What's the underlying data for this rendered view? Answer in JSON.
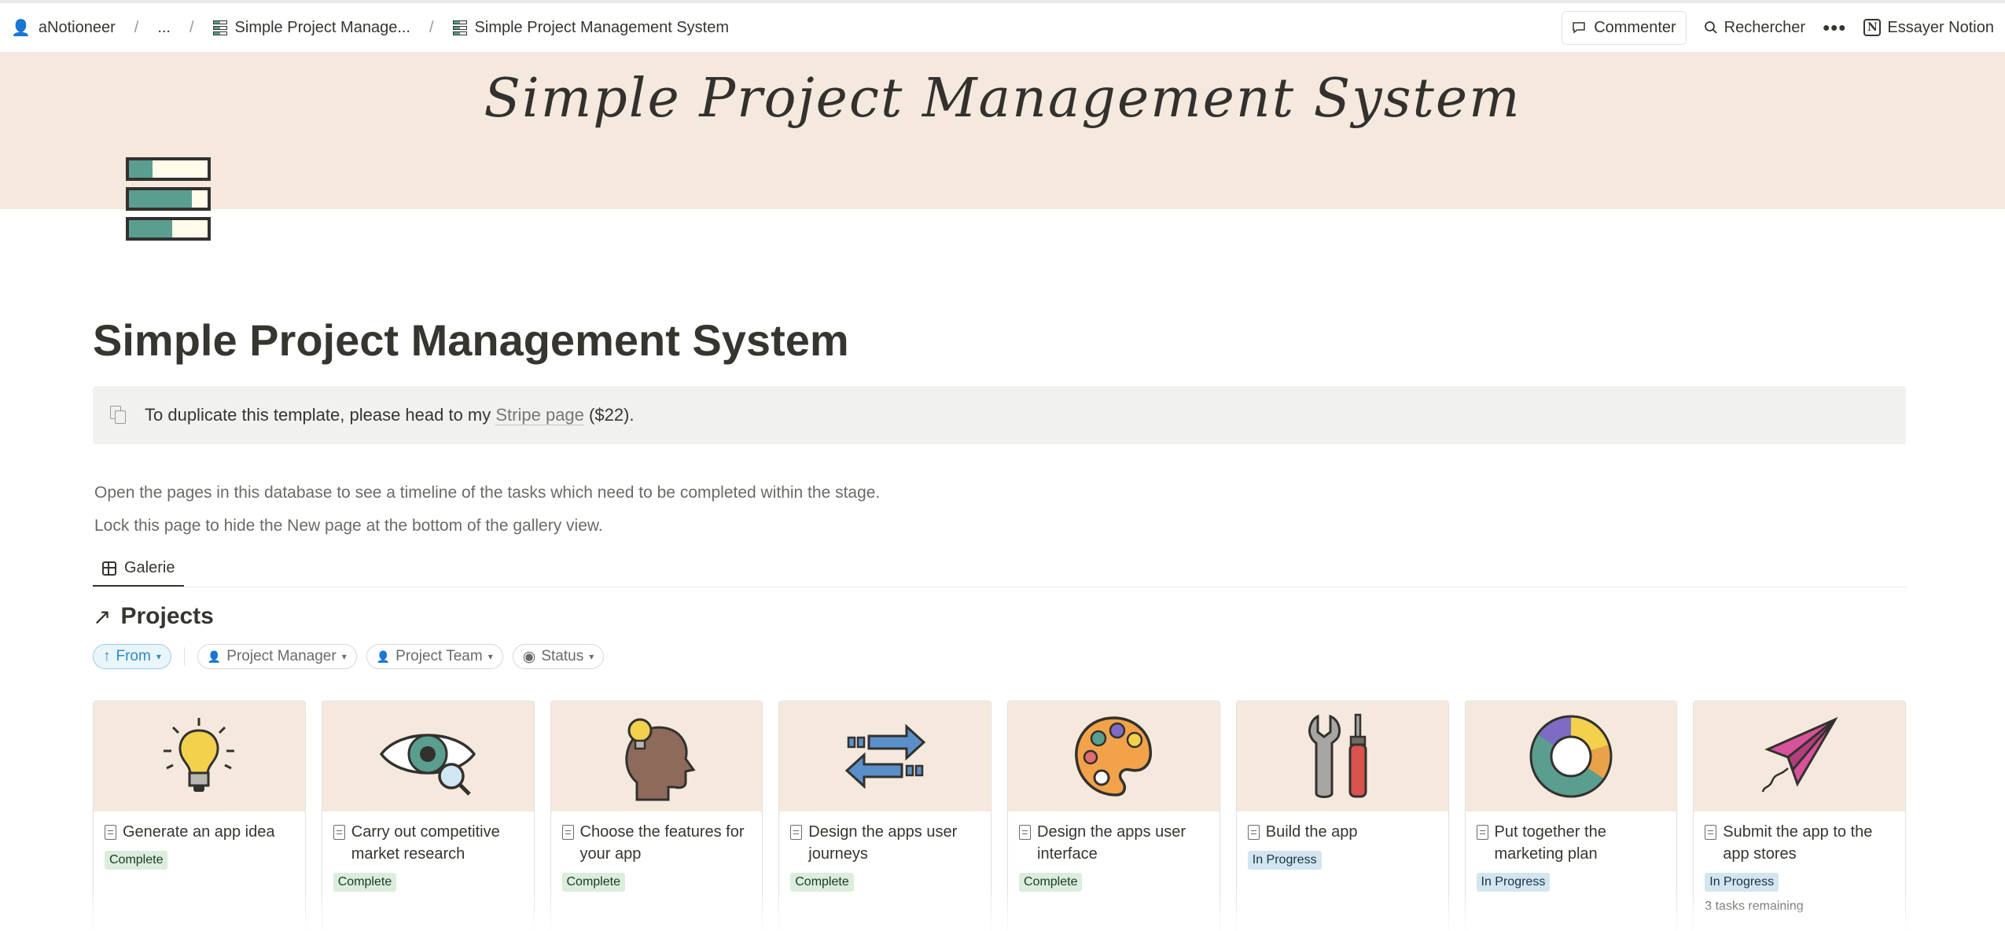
{
  "breadcrumb": {
    "workspace": "aNotioneer",
    "ellipsis": "...",
    "parent": "Simple Project Manage...",
    "current": "Simple Project Management System"
  },
  "topbar": {
    "comment": "Commenter",
    "search": "Rechercher",
    "more": "•••",
    "try_notion": "Essayer Notion"
  },
  "cover": {
    "title": "Simple Project Management System"
  },
  "page": {
    "title": "Simple Project Management System",
    "callout_before": "To duplicate this template, please head to my ",
    "callout_link": "Stripe page",
    "callout_after": " ($22).",
    "para1": "Open the pages in this database to see a timeline of the tasks which need to be completed within the stage.",
    "para2": "Lock this page to hide the New page at the bottom of the gallery view."
  },
  "view": {
    "tab": "Galerie",
    "db_title": "Projects"
  },
  "filters": {
    "sort": "From",
    "project_manager": "Project Manager",
    "project_team": "Project Team",
    "status": "Status"
  },
  "cards": [
    {
      "title": "Generate an app idea",
      "status": "Complete",
      "extra": ""
    },
    {
      "title": "Carry out competitive market research",
      "status": "Complete",
      "extra": ""
    },
    {
      "title": "Choose the features for your app",
      "status": "Complete",
      "extra": ""
    },
    {
      "title": "Design the apps user journeys",
      "status": "Complete",
      "extra": ""
    },
    {
      "title": "Design the apps user interface",
      "status": "Complete",
      "extra": ""
    },
    {
      "title": "Build the app",
      "status": "In Progress",
      "extra": ""
    },
    {
      "title": "Put together the marketing plan",
      "status": "In Progress",
      "extra": ""
    },
    {
      "title": "Submit the app to the app stores",
      "status": "In Progress",
      "extra": "3 tasks remaining"
    }
  ],
  "colors": {
    "cover_bg": "#f5e9de",
    "accent_teal": "#5a9e8f",
    "complete_bg": "#dbeddb",
    "progress_bg": "#d3e5ef",
    "sort_chip": "#2b8bc6"
  }
}
